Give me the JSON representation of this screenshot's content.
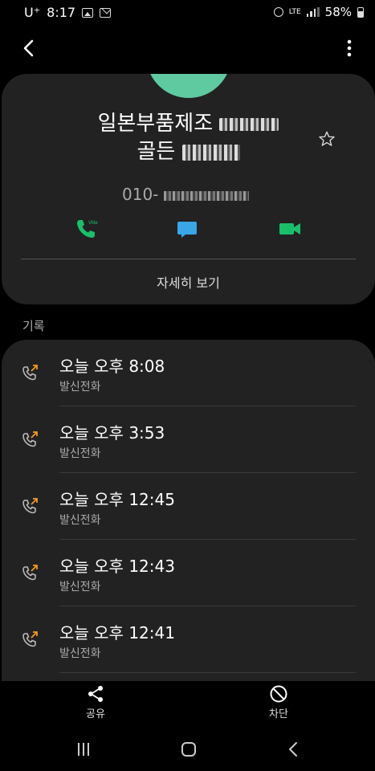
{
  "status": {
    "carrier": "U⁺",
    "time": "8:17",
    "network": "LTE",
    "battery": "58%"
  },
  "contact": {
    "name_line1": "일본부품제조",
    "name_line2": "골든",
    "phone_prefix": "010-",
    "detail_label": "자세히 보기"
  },
  "colors": {
    "accent_green": "#19c06a",
    "message_blue": "#3aa6e8",
    "outgoing_arrow": "#f39a23"
  },
  "log": {
    "section_label": "기록",
    "items": [
      {
        "time": "오늘 오후 8:08",
        "type": "발신전화"
      },
      {
        "time": "오늘 오후 3:53",
        "type": "발신전화"
      },
      {
        "time": "오늘 오후 12:45",
        "type": "발신전화"
      },
      {
        "time": "오늘 오후 12:43",
        "type": "발신전화"
      },
      {
        "time": "오늘 오후 12:41",
        "type": "발신전화"
      }
    ]
  },
  "actions": {
    "share_label": "공유",
    "block_label": "차단"
  }
}
